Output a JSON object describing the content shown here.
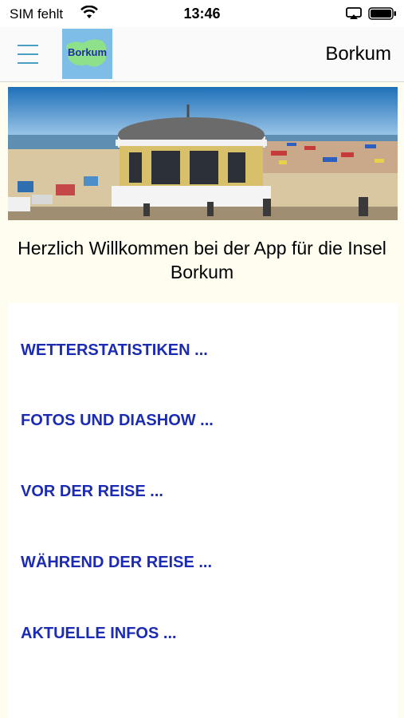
{
  "status_bar": {
    "carrier": "SIM fehlt",
    "time": "13:46",
    "wifi_icon": "wifi-icon",
    "airplay_icon": "airplay-icon",
    "battery_icon": "battery-icon"
  },
  "nav": {
    "menu_icon": "hamburger-menu-icon",
    "logo_text": "Borkum",
    "title": "Borkum"
  },
  "hero": {
    "image": "beach-pavilion-photo"
  },
  "welcome_text": "Herzlich Willkommen bei der App für die Insel Borkum",
  "menu": {
    "items": [
      {
        "label": "WETTERSTATISTIKEN ..."
      },
      {
        "label": "FOTOS UND DIASHOW ..."
      },
      {
        "label": "VOR DER REISE ..."
      },
      {
        "label": "WÄHREND DER REISE ..."
      },
      {
        "label": "AKTUELLE INFOS ..."
      }
    ]
  },
  "colors": {
    "link": "#1c2bb3",
    "background": "#fffdf0",
    "menu_icon": "#4a9fc4",
    "logo_bg": "#7ebde6"
  }
}
